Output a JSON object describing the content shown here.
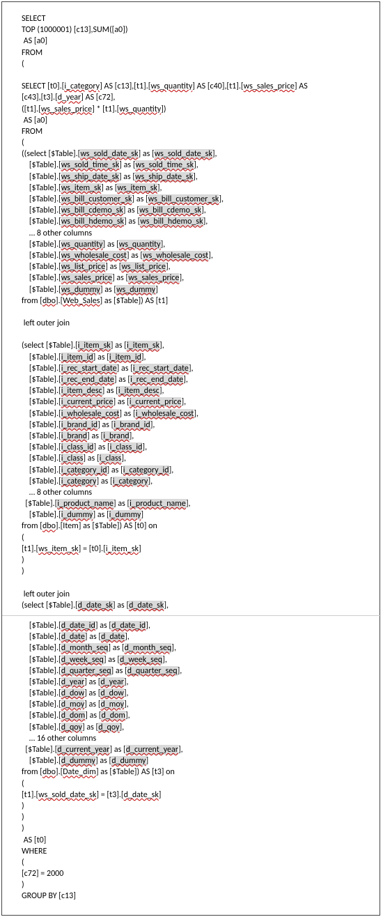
{
  "sql": {
    "l1": "SELECT",
    "l2": "TOP (1000001) [c13],SUM([a0])",
    "l3": " AS [a0]",
    "l4": "FROM",
    "l5": "(",
    "l6": "",
    "l7a": "SELECT [t0].[",
    "l7b": "i_category",
    "l7c": "] AS [c13],[t1].[",
    "l7d": "ws_quantity",
    "l7e": "] AS [c40],[t1].[",
    "l7f": "ws_sales_price",
    "l7g": "] AS",
    "l8a": "[c43],[t3].[",
    "l8b": "d_year",
    "l8c": "] AS [c72],",
    "l9a": "([t1].[",
    "l9b": "ws_sales_price",
    "l9c": "] * [t1].[",
    "l9d": "ws_quantity",
    "l9e": "])",
    "l10": " AS [a0]",
    "l11": "FROM",
    "l12": "(",
    "l13a": "((select [$Table].[",
    "l13b": "ws_sold_date_sk",
    "l13c": "] as [",
    "l13d": "ws_sold_date_sk",
    "l13e": "],",
    "ws_cols": [
      {
        "pre": "    [$Table].[",
        "name": "ws_sold_time_sk",
        "mid": "] as [",
        "name2": "ws_sold_time_sk",
        "post": "],"
      },
      {
        "pre": "    [$Table].[",
        "name": "ws_ship_date_sk",
        "mid": "] as [",
        "name2": "ws_ship_date_sk",
        "post": "],"
      },
      {
        "pre": "    [$Table].[",
        "name": "ws_item_sk",
        "mid": "] as [",
        "name2": "ws_item_sk",
        "post": "],"
      },
      {
        "pre": "    [$Table].[",
        "name": "ws_bill_customer_sk",
        "mid": "] as [",
        "name2": "ws_bill_customer_sk",
        "post": "],"
      },
      {
        "pre": "    [$Table].[",
        "name": "ws_bill_cdemo_sk",
        "mid": "] as [",
        "name2": "ws_bill_cdemo_sk",
        "post": "],"
      },
      {
        "pre": "    [$Table].[",
        "name": "ws_bill_hdemo_sk",
        "mid": "] as [",
        "name2": "ws_bill_hdemo_sk",
        "post": "],"
      }
    ],
    "ws_more": "    … 8 other columns",
    "ws_cols2": [
      {
        "pre": "    [$Table].[",
        "name": "ws_quantity",
        "mid": "] as [",
        "name2": "ws_quantity",
        "post": "],"
      },
      {
        "pre": "    [$Table].[",
        "name": "ws_wholesale_cost",
        "mid": "] as [",
        "name2": "ws_wholesale_cost",
        "post": "],"
      },
      {
        "pre": "    [$Table].[",
        "name": "ws_list_price",
        "mid": "] as [",
        "name2": "ws_list_price",
        "post": "],"
      },
      {
        "pre": "    [$Table].[",
        "name": "ws_sales_price",
        "mid": "] as [",
        "name2": "ws_sales_price",
        "post": "],"
      },
      {
        "pre": "    [$Table].[",
        "name": "ws_dummy",
        "mid": "] as [",
        "name2": "ws_dummy",
        "post": "]"
      }
    ],
    "ws_from_a": "from [",
    "ws_from_b": "dbo",
    "ws_from_c": "].[",
    "ws_from_d": "Web_Sales",
    "ws_from_e": "] as [$Table]) AS [t1]",
    "loj1": " left outer join",
    "i_open_a": "(select [$Table].[",
    "i_open_b": "i_item_sk",
    "i_open_c": "] as [",
    "i_open_d": "i_item_sk",
    "i_open_e": "],",
    "i_cols": [
      {
        "pre": "    [$Table].[",
        "name": "i_item_id",
        "mid": "] as [",
        "name2": "i_item_id",
        "post": "],"
      },
      {
        "pre": "    [$Table].[",
        "name": "i_rec_start_date",
        "mid": "] as [",
        "name2": "i_rec_start_date",
        "post": "],"
      },
      {
        "pre": "    [$Table].[",
        "name": "i_rec_end_date",
        "mid": "] as [",
        "name2": "i_rec_end_date",
        "post": "],"
      },
      {
        "pre": "    [$Table].[",
        "name": "i_item_desc",
        "mid": "] as [",
        "name2": "i_item_desc",
        "post": "],"
      },
      {
        "pre": "    [$Table].[",
        "name": "i_current_price",
        "mid": "] as [",
        "name2": "i_current_price",
        "post": "],"
      },
      {
        "pre": "    [$Table].[",
        "name": "i_wholesale_cost",
        "mid": "] as [",
        "name2": "i_wholesale_cost",
        "post": "],"
      },
      {
        "pre": "    [$Table].[",
        "name": "i_brand_id",
        "mid": "] as [",
        "name2": "i_brand_id",
        "post": "],"
      },
      {
        "pre": "    [$Table].[",
        "name": "i_brand",
        "mid": "] as [",
        "name2": "i_brand",
        "post": "],"
      },
      {
        "pre": "    [$Table].[",
        "name": "i_class_id",
        "mid": "] as [",
        "name2": "i_class_id",
        "post": "],"
      },
      {
        "pre": "    [$Table].[",
        "name": "i_class",
        "mid": "] as [",
        "name2": "i_class",
        "post": "],"
      },
      {
        "pre": "    [$Table].[",
        "name": "i_category_id",
        "mid": "] as [",
        "name2": "i_category_id",
        "post": "],"
      },
      {
        "pre": "    [$Table].[",
        "name": "i_category",
        "mid": "] as [",
        "name2": "i_category",
        "post": "],"
      }
    ],
    "i_more": "    … 8 other columns",
    "i_cols2": [
      {
        "pre": "  [$Table].[",
        "name": "i_product_name",
        "mid": "] as [",
        "name2": "i_product_name",
        "post": "],"
      },
      {
        "pre": "    [$Table].[",
        "name": "i_dummy",
        "mid": "] as [",
        "name2": "i_dummy",
        "post": "]"
      }
    ],
    "i_from_a": "from [",
    "i_from_b": "dbo",
    "i_from_c": "].[Item] as [$Table]) AS [t0] on",
    "on1_open": "(",
    "on1_a": "[t1].[",
    "on1_b": "ws_item_sk",
    "on1_c": "] = [t0].[",
    "on1_d": "i_item_sk",
    "on1_e": "]",
    "on1_close": ")",
    "on1_close2": ")",
    "loj2": " left outer join",
    "d_open_a": "(select [$Table].[",
    "d_open_b": "d_date_sk",
    "d_open_c": "] as [",
    "d_open_d": "d_date_sk",
    "d_open_e": "],",
    "d_cols": [
      {
        "pre": "    [$Table].[",
        "name": "d_date_id",
        "mid": "] as [",
        "name2": "d_date_id",
        "post": "],"
      },
      {
        "pre": "    [$Table].[",
        "name": "d_date",
        "mid": "] as [",
        "name2": "d_date",
        "post": "],"
      },
      {
        "pre": "    [$Table].[",
        "name": "d_month_seq",
        "mid": "] as [",
        "name2": "d_month_seq",
        "post": "],"
      },
      {
        "pre": "    [$Table].[",
        "name": "d_week_seq",
        "mid": "] as [",
        "name2": "d_week_seq",
        "post": "],"
      },
      {
        "pre": "    [$Table].[",
        "name": "d_quarter_seq",
        "mid": "] as [",
        "name2": "d_quarter_seq",
        "post": "],"
      },
      {
        "pre": "    [$Table].[",
        "name": "d_year",
        "mid": "] as [",
        "name2": "d_year",
        "post": "],"
      },
      {
        "pre": "    [$Table].[",
        "name": "d_dow",
        "mid": "] as [",
        "name2": "d_dow",
        "post": "],"
      },
      {
        "pre": "    [$Table].[",
        "name": "d_moy",
        "mid": "] as [",
        "name2": "d_moy",
        "post": "],"
      },
      {
        "pre": "    [$Table].[",
        "name": "d_dom",
        "mid": "] as [",
        "name2": "d_dom",
        "post": "],"
      },
      {
        "pre": "    [$Table].[",
        "name": "d_qoy",
        "mid": "] as [",
        "name2": "d_qoy",
        "post": "],"
      }
    ],
    "d_more": "    … 16 other columns",
    "d_cols2": [
      {
        "pre": "  [$Table].[",
        "name": "d_current_year",
        "mid": "] as [",
        "name2": "d_current_year",
        "post": "],"
      },
      {
        "pre": "    [$Table].[",
        "name": "d_dummy",
        "mid": "] as [",
        "name2": "d_dummy",
        "post": "]"
      }
    ],
    "d_from_a": "from [",
    "d_from_b": "dbo",
    "d_from_c": "].[",
    "d_from_d": "Date_dim",
    "d_from_e": "] as [$Table]) AS [t3] on",
    "on2_open": "(",
    "on2_a": "[t1].[",
    "on2_b": "ws_sold_date_sk",
    "on2_c": "] = [t3].[",
    "on2_d": "d_date_sk",
    "on2_e": "]",
    "on2_close": ")",
    "on2_close2": ")",
    "on2_close3": ")",
    "as_t0": " AS [t0]",
    "where": "WHERE",
    "w_open": "(",
    "w_cond": "[c72] = 2000",
    "w_close": ")",
    "groupby": "GROUP BY [c13]"
  }
}
